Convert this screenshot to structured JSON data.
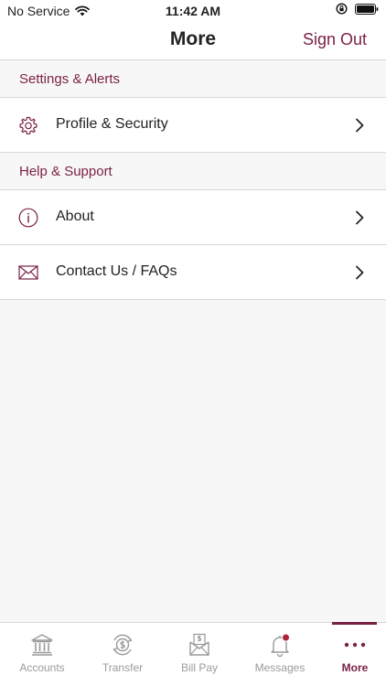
{
  "status_bar": {
    "carrier": "No Service",
    "time": "11:42 AM"
  },
  "nav": {
    "title": "More",
    "sign_out": "Sign Out"
  },
  "sections": [
    {
      "header": "Settings & Alerts",
      "items": [
        {
          "label": "Profile & Security",
          "icon": "gear-icon"
        }
      ]
    },
    {
      "header": "Help & Support",
      "items": [
        {
          "label": "About",
          "icon": "info-icon"
        },
        {
          "label": "Contact Us / FAQs",
          "icon": "envelope-icon"
        }
      ]
    }
  ],
  "tab_bar": {
    "tabs": [
      {
        "label": "Accounts",
        "icon": "bank-icon",
        "active": false
      },
      {
        "label": "Transfer",
        "icon": "transfer-icon",
        "active": false
      },
      {
        "label": "Bill Pay",
        "icon": "bill-pay-icon",
        "active": false
      },
      {
        "label": "Messages",
        "icon": "bell-icon",
        "active": false,
        "badge": true
      },
      {
        "label": "More",
        "icon": "more-dots-icon",
        "active": true
      }
    ]
  },
  "colors": {
    "accent": "#7a1f45",
    "inactive": "#9a9a9a",
    "badge": "#b0223c",
    "background": "#f7f7f7"
  }
}
